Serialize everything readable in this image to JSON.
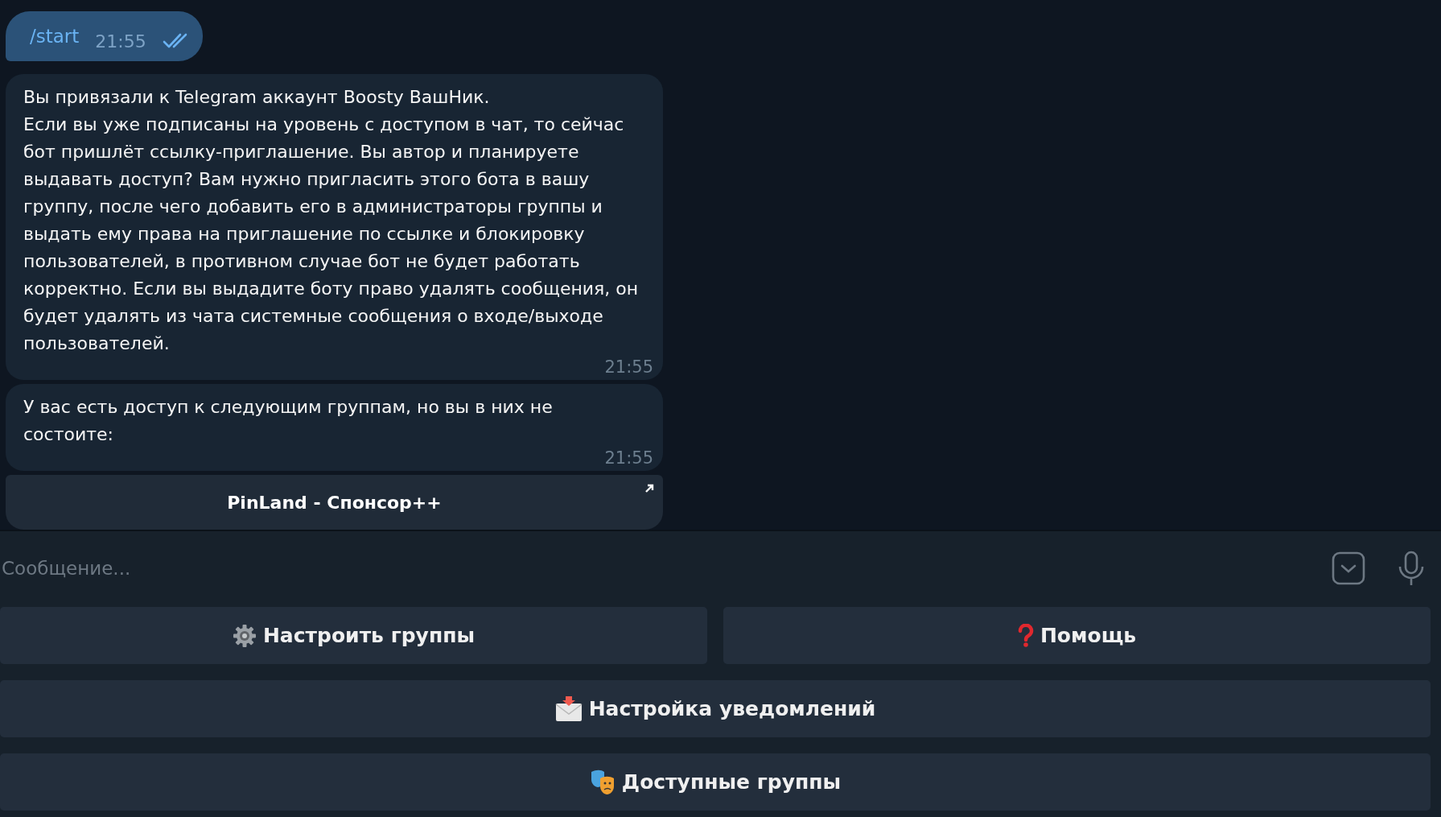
{
  "outgoing": {
    "text": "/start",
    "time": "21:55",
    "read": true
  },
  "messages": [
    {
      "text": "Вы привязали к Telegram аккаунт Boosty ВашНик.\nЕсли вы уже подписаны на уровень с доступом в чат, то сейчас бот пришлёт ссылку-приглашение. Вы автор и планируете выдавать доступ? Вам нужно пригласить этого бота в вашу группу, после чего добавить его в администраторы группы и выдать ему права на приглашение по ссылке и блокировку пользователей, в противном случае бот не будет работать корректно. Если вы выдадите боту право удалять сообщения, он будет удалять из чата системные сообщения о входе/выходе пользователей.",
      "time": "21:55"
    },
    {
      "text": "У вас есть доступ к следующим группам, но вы в них не состоите:",
      "time": "21:55"
    }
  ],
  "inline_buttons": [
    {
      "label": "PinLand - Спонсор++"
    }
  ],
  "composer": {
    "placeholder": "Сообщение..."
  },
  "keyboard": [
    [
      {
        "kind": "gear",
        "label": "Настроить группы"
      },
      {
        "kind": "question",
        "label": "Помощь"
      }
    ],
    [
      {
        "kind": "envelope",
        "label": "Настройка уведомлений"
      }
    ],
    [
      {
        "kind": "masks",
        "label": "Доступные группы"
      }
    ]
  ]
}
